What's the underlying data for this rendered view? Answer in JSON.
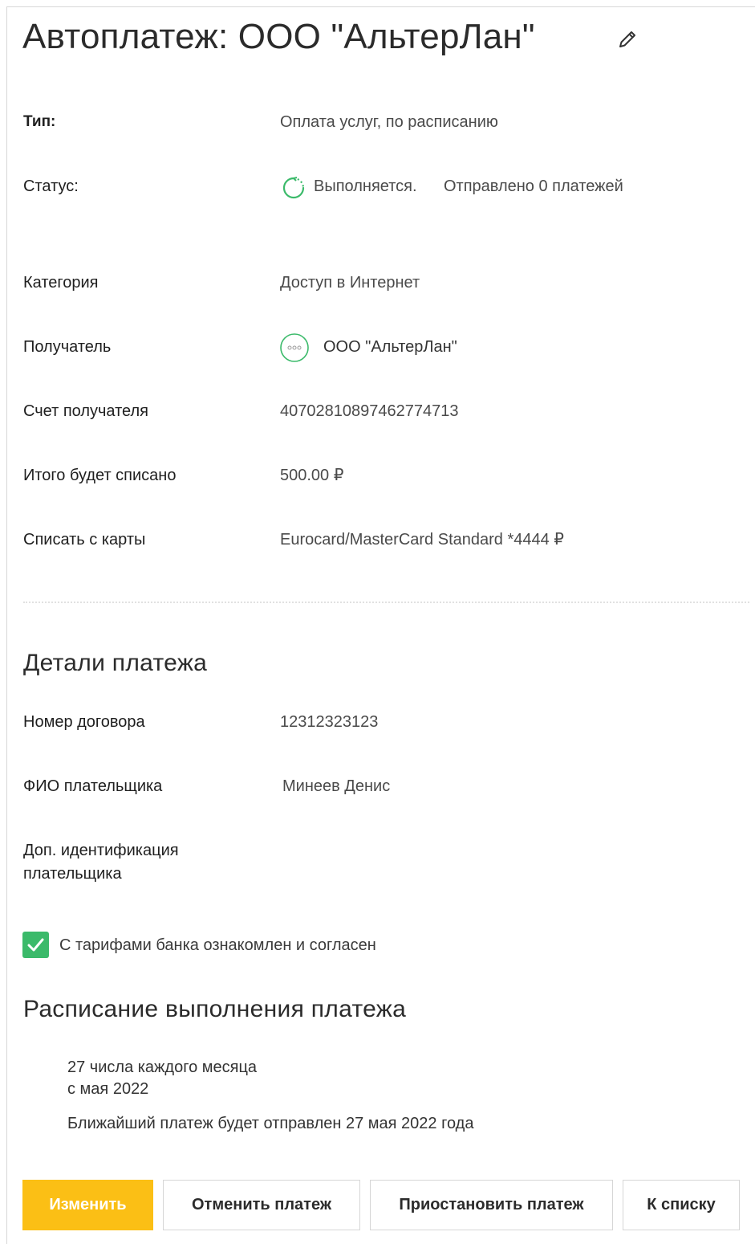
{
  "header": {
    "title": "Автоплатеж: ООО \"АльтерЛан\"",
    "edit_icon": "pencil-icon"
  },
  "details": {
    "type": {
      "label": "Тип:",
      "value": "Оплата услуг, по расписанию"
    },
    "status": {
      "label": "Статус:",
      "icon": "loading-spinner-icon",
      "value": "Выполняется.",
      "sent": "Отправлено 0 платежей"
    },
    "category": {
      "label": "Категория",
      "value": "Доступ в Интернет"
    },
    "recipient": {
      "label": "Получатель",
      "icon": "organization-placeholder-icon",
      "value": "ООО \"АльтерЛан\""
    },
    "account": {
      "label": "Счет получателя",
      "value": "40702810897462774713"
    },
    "total": {
      "label": "Итого будет списано",
      "value": "500.00 ₽"
    },
    "card": {
      "label": "Списать с карты",
      "value": "Eurocard/MasterCard Standard *4444 ₽"
    }
  },
  "payment_details": {
    "title": "Детали платежа",
    "contract": {
      "label": "Номер договора",
      "value": "12312323123"
    },
    "payer_name": {
      "label": "ФИО плательщика",
      "value": "Минеев Денис"
    },
    "extra_id": {
      "label_line1": "Доп. идентификация",
      "label_line2": "плательщика",
      "value": ""
    }
  },
  "agreement": {
    "checked": true,
    "label": "С тарифами банка ознакомлен и согласен"
  },
  "schedule": {
    "title": "Расписание выполнения платежа",
    "line1": "27 числа каждого месяца",
    "line2": "с мая 2022",
    "next_payment": "Ближайший платеж будет отправлен 27 мая 2022 года"
  },
  "actions": {
    "edit": "Изменить",
    "cancel": "Отменить платеж",
    "pause": "Приостановить платеж",
    "to_list": "К списку"
  },
  "colors": {
    "accent_green": "#3bba6a",
    "primary_button": "#fbbf15",
    "border": "#d6d6d6"
  }
}
